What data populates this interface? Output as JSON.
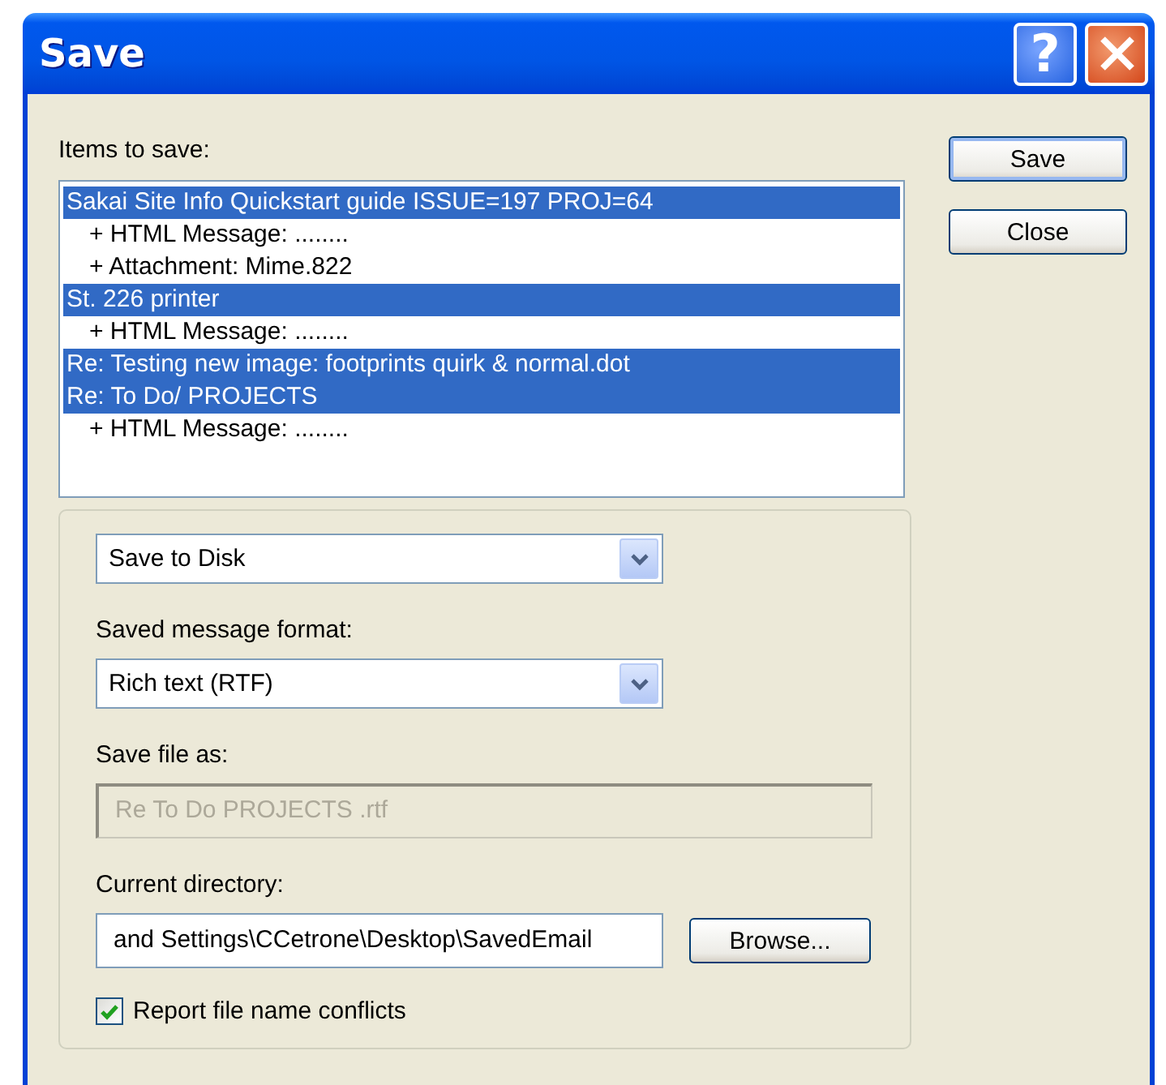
{
  "window": {
    "title": "Save"
  },
  "help_button": {
    "label": "?"
  },
  "items_label": {
    "text": "Items to save:"
  },
  "items": [
    {
      "text": "Sakai Site Info Quickstart guide ISSUE=197 PROJ=64",
      "selected": true,
      "children": [
        {
          "text": "+ HTML Message: ........",
          "selected": false
        },
        {
          "text": "+ Attachment: Mime.822",
          "selected": false
        }
      ]
    },
    {
      "text": "St. 226 printer",
      "selected": true,
      "children": [
        {
          "text": "+ HTML Message: ........",
          "selected": false
        }
      ]
    },
    {
      "text": "Re: Testing new image: footprints quirk & normal.dot",
      "selected": true
    },
    {
      "text": "Re: To Do/ PROJECTS",
      "selected": true,
      "children": [
        {
          "text": "+ HTML Message: ........",
          "selected": false
        }
      ]
    }
  ],
  "buttons": [
    {
      "label": "Save",
      "default": true
    },
    {
      "label": "Close",
      "default": false
    }
  ],
  "destination": {
    "value": "Save to Disk"
  },
  "format": {
    "label": "Saved message format:",
    "value": "Rich text (RTF)"
  },
  "file_name": {
    "label": "Save file as:",
    "value": "Re To Do PROJECTS .rtf",
    "disabled": true
  },
  "directory": {
    "label": "Current directory:",
    "value": "and Settings\\CCetrone\\Desktop\\SavedEmail",
    "disabled": false
  },
  "browse_button": {
    "label": "Browse..."
  },
  "report_conflicts": {
    "label": "Report file name conflicts",
    "checked": true
  }
}
